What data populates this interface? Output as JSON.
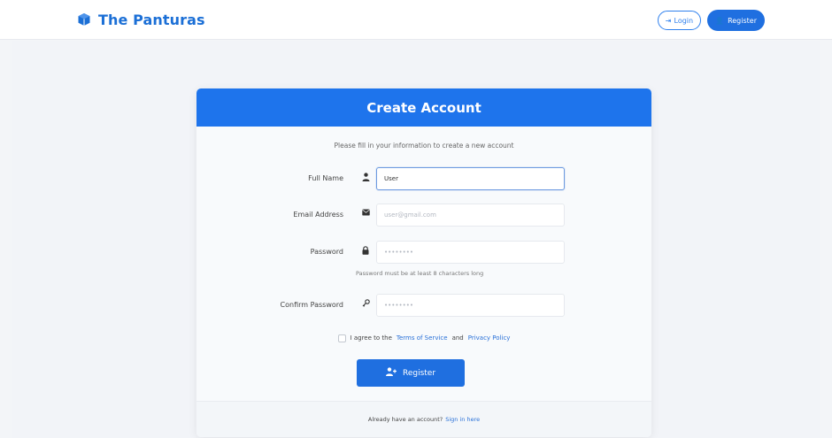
{
  "app": {
    "title": "The Panturas"
  },
  "nav": {
    "login_label": "Login",
    "register_label": "Register"
  },
  "card": {
    "title": "Create Account",
    "subtitle": "Please fill in your information to create a new account",
    "fields": [
      {
        "label": "Full Name",
        "icon": "user-icon",
        "value": "User",
        "placeholder": ""
      },
      {
        "label": "Email Address",
        "icon": "envelope-icon",
        "value": "",
        "placeholder": "user@gmail.com"
      },
      {
        "label": "Password",
        "icon": "lock-icon",
        "value": "",
        "placeholder": "••••••••"
      },
      {
        "label": "Confirm Password",
        "icon": "key-icon",
        "value": "",
        "placeholder": "••••••••"
      }
    ],
    "password_hint": "Password must be at least 8 characters long",
    "agree_prefix": "I agree to the",
    "terms_label": "Terms of Service",
    "agree_and": "and",
    "privacy_label": "Privacy Policy",
    "register_button": "Register",
    "footer_prefix": "Already have an account?",
    "footer_link": "Sign in here"
  },
  "colors": {
    "accent": "#1e74ec",
    "brand": "#1b6fd6"
  }
}
